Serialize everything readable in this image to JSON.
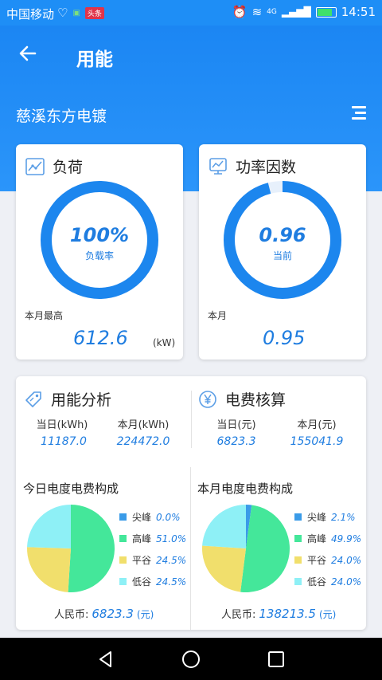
{
  "status_bar": {
    "carrier": "中国移动",
    "badge": "头条",
    "network": "4G",
    "time": "14:51"
  },
  "header": {
    "back_icon": "arrow-left-icon",
    "title": "用能",
    "company": "慈溪东方电镀",
    "menu_icon": "menu-icon"
  },
  "load_card": {
    "title": "负荷",
    "icon": "line-chart-icon",
    "ring_value": "100%",
    "ring_label": "负载率",
    "ring_fraction": 1.0,
    "stat_label": "本月最高",
    "stat_value": "612.6",
    "unit": "(kW)"
  },
  "pf_card": {
    "title": "功率因数",
    "icon": "monitor-chart-icon",
    "ring_value": "0.96",
    "ring_label": "当前",
    "ring_fraction": 0.96,
    "stat_label": "本月",
    "stat_value": "0.95"
  },
  "analysis": {
    "energy": {
      "title": "用能分析",
      "icon": "tag-icon",
      "day_label": "当日(kWh)",
      "day_value": "11187.0",
      "month_label": "本月(kWh)",
      "month_value": "224472.0"
    },
    "fee": {
      "title": "电费核算",
      "icon": "yen-icon",
      "day_label": "当日(元)",
      "day_value": "6823.3",
      "month_label": "本月(元)",
      "month_value": "155041.9"
    },
    "today_pie": {
      "title": "今日电度电费构成",
      "rmb_label": "人民币:",
      "rmb_value": "6823.3",
      "rmb_unit": "(元)"
    },
    "month_pie": {
      "title": "本月电度电费构成",
      "rmb_label": "人民币:",
      "rmb_value": "138213.5",
      "rmb_unit": "(元)"
    }
  },
  "colors": {
    "primary": "#1f7de0",
    "header": "#1e8ef6",
    "peak_sharp": "#3a9be8",
    "peak": "#44e79a",
    "flat": "#f1df6c",
    "valley": "#8ef0f6"
  },
  "chart_data": [
    {
      "type": "pie",
      "title": "今日电度电费构成",
      "labels": [
        "尖峰",
        "高峰",
        "平谷",
        "低谷"
      ],
      "label_texts": [
        "0.0%",
        "51.0%",
        "24.5%",
        "24.5%"
      ],
      "values": [
        0.0,
        51.0,
        24.5,
        24.5
      ]
    },
    {
      "type": "pie",
      "title": "本月电度电费构成",
      "labels": [
        "尖峰",
        "高峰",
        "平谷",
        "低谷"
      ],
      "label_texts": [
        "2.1%",
        "49.9%",
        "24.0%",
        "24.0%"
      ],
      "values": [
        2.1,
        49.9,
        24.0,
        24.0
      ]
    }
  ]
}
